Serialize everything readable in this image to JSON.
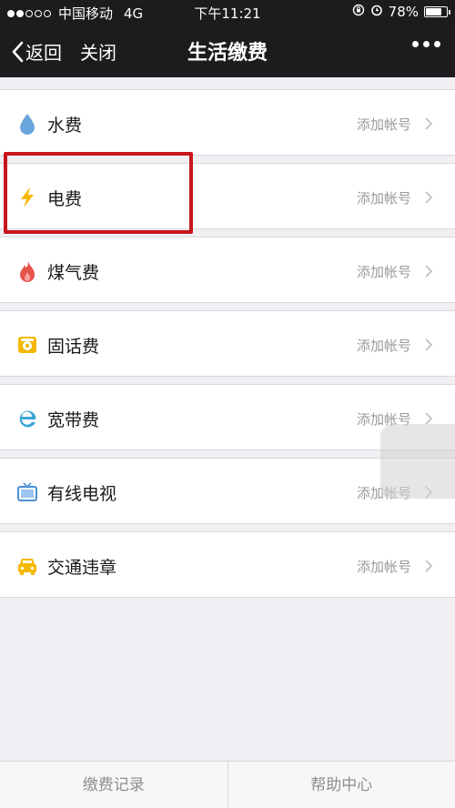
{
  "status_bar": {
    "carrier": "中国移动",
    "network": "4G",
    "time": "下午11:21",
    "battery": "78%",
    "battery_level": 0.78
  },
  "nav": {
    "back_label": "返回",
    "close_label": "关闭",
    "title": "生活缴费"
  },
  "services": [
    {
      "label": "水费",
      "action": "添加帐号",
      "icon": "water-drop-icon",
      "color": "#5b9bd5"
    },
    {
      "label": "电费",
      "action": "添加帐号",
      "icon": "lightning-icon",
      "color": "#f5b800"
    },
    {
      "label": "煤气费",
      "action": "添加帐号",
      "icon": "flame-icon",
      "color": "#e5534b"
    },
    {
      "label": "固话费",
      "action": "添加帐号",
      "icon": "telephone-icon",
      "color": "#f5b800"
    },
    {
      "label": "宽带费",
      "action": "添加帐号",
      "icon": "internet-explorer-icon",
      "color": "#3aa6d6"
    },
    {
      "label": "有线电视",
      "action": "添加帐号",
      "icon": "tv-icon",
      "color": "#4a8fd4"
    },
    {
      "label": "交通违章",
      "action": "添加帐号",
      "icon": "car-icon",
      "color": "#f5b800"
    }
  ],
  "footer": {
    "records": "缴费记录",
    "help": "帮助中心"
  }
}
